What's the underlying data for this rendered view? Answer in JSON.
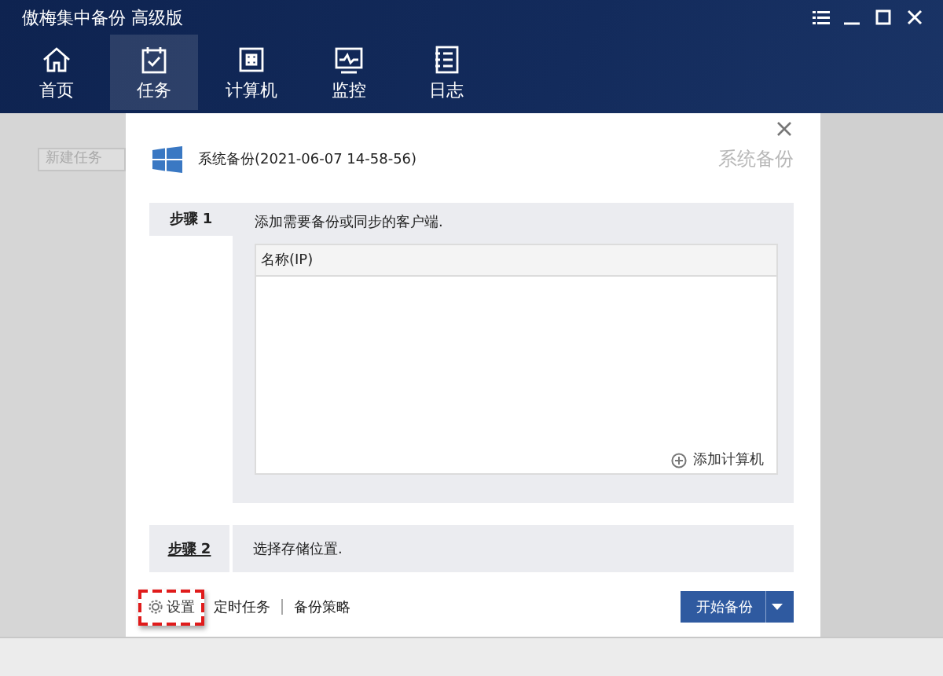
{
  "window": {
    "title": "傲梅集中备份 高级版"
  },
  "nav": [
    {
      "label": "首页",
      "selected": false
    },
    {
      "label": "任务",
      "selected": true
    },
    {
      "label": "计算机",
      "selected": false
    },
    {
      "label": "监控",
      "selected": false
    },
    {
      "label": "日志",
      "selected": false
    }
  ],
  "sidebar": {
    "new_task": "新建任务"
  },
  "dialog": {
    "title": "系统备份(2021-06-07 14-58-56)",
    "type_label": "系统备份",
    "step1": {
      "label": "步骤 1",
      "description": "添加需要备份或同步的客户端.",
      "table": {
        "columns": [
          "名称(IP)"
        ]
      },
      "add_link": "添加计算机"
    },
    "step2": {
      "label": "步骤 2",
      "description": "选择存储位置."
    },
    "footer": {
      "settings": "设置",
      "settings_highlighted": true,
      "links": [
        "定时任务",
        "备份策略"
      ],
      "start_button": "开始备份"
    }
  }
}
